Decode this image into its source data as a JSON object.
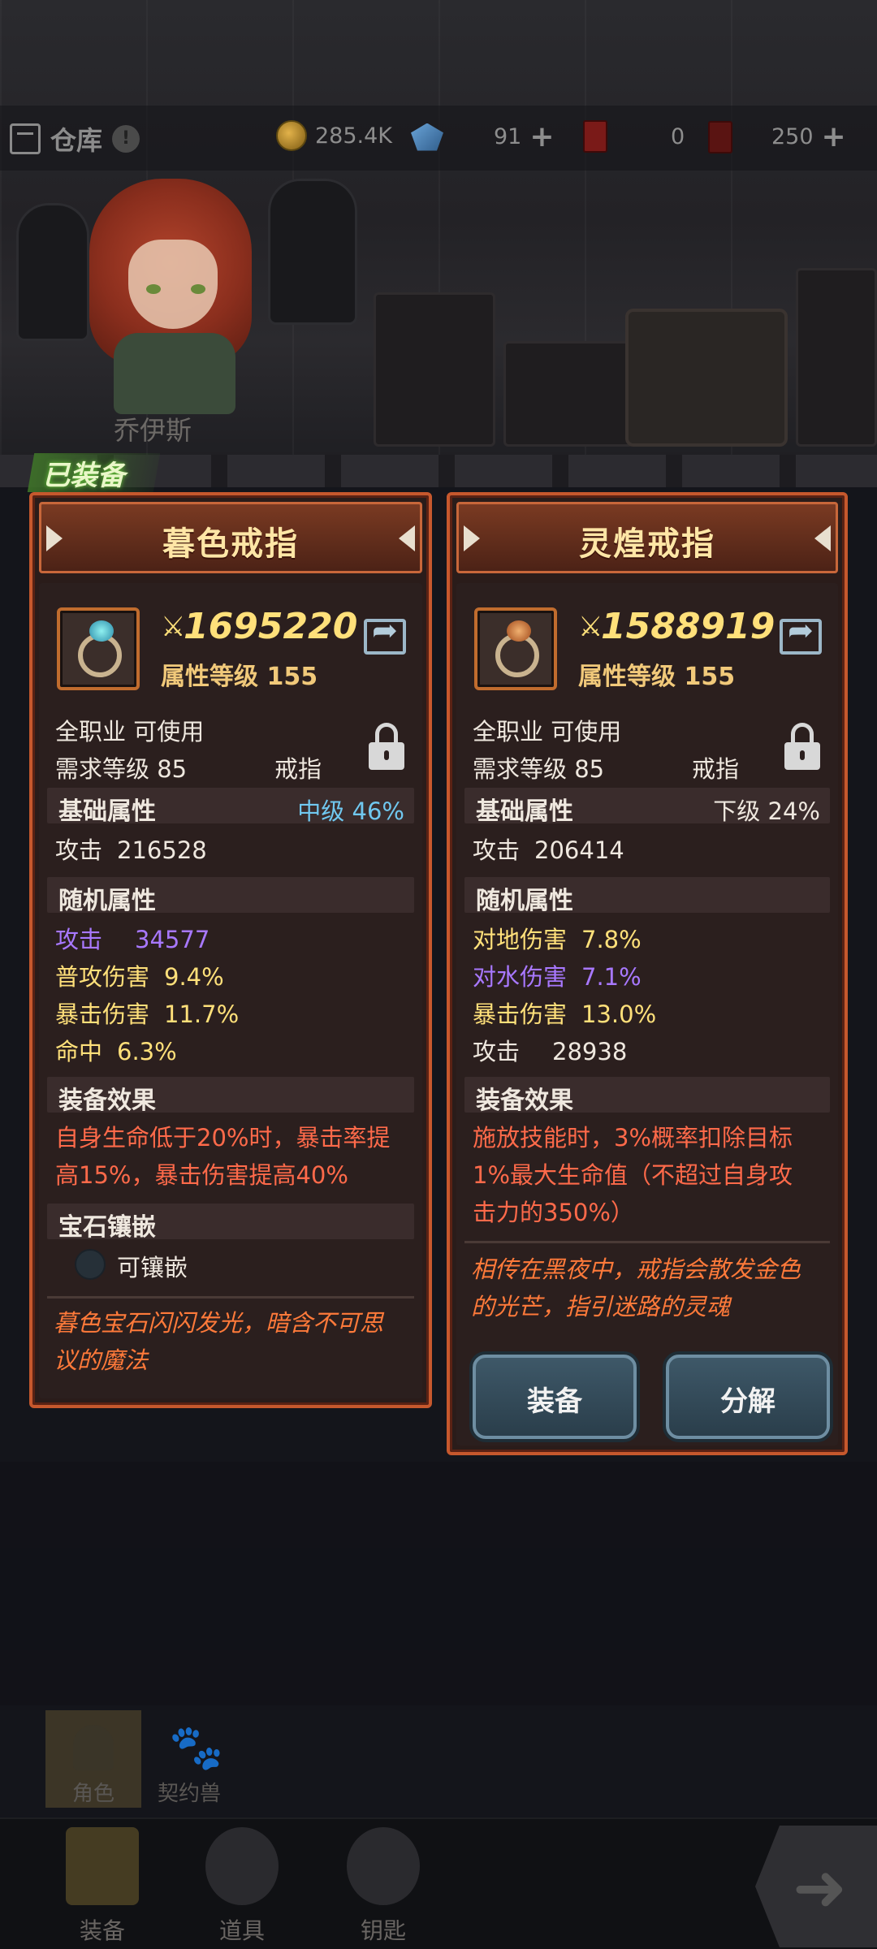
{
  "topbar": {
    "warehouse_label": "仓库",
    "info_mark": "!",
    "gold": "285.4K",
    "gems": "91",
    "ticket_red": "0",
    "ticket_dark": "250",
    "plus": "+"
  },
  "character": {
    "name": "乔伊斯",
    "equipped_badge": "已装备"
  },
  "left_item": {
    "title": "暮色戒指",
    "power": "1695220",
    "attr_level_label": "属性等级 155",
    "class_req": "全职业 可使用",
    "level_req": "需求等级 85",
    "slot": "戒指",
    "base_section": "基础属性",
    "base_grade": "中级",
    "base_percent": "46%",
    "base_stat": {
      "name": "攻击",
      "value": "216528"
    },
    "random_section": "随机属性",
    "random_stats": [
      {
        "name": "攻击",
        "value": "34577"
      },
      {
        "name": "普攻伤害",
        "value": "9.4%"
      },
      {
        "name": "暴击伤害",
        "value": "11.7%"
      },
      {
        "name": "命中",
        "value": "6.3%"
      }
    ],
    "effect_section": "装备效果",
    "effect_line1": "自身生命低于20%时，暴击率提",
    "effect_line2": "高15%，暴击伤害提高40%",
    "gem_section": "宝石镶嵌",
    "socket_label": "可镶嵌",
    "flavor_line1": "暮色宝石闪闪发光，暗含不可思",
    "flavor_line2": "议的魔法"
  },
  "right_item": {
    "title": "灵煌戒指",
    "power": "1588919",
    "attr_level_label": "属性等级 155",
    "class_req": "全职业 可使用",
    "level_req": "需求等级 85",
    "slot": "戒指",
    "base_section": "基础属性",
    "base_grade": "下级",
    "base_percent": "24%",
    "base_stat": {
      "name": "攻击",
      "value": "206414"
    },
    "random_section": "随机属性",
    "random_stats": [
      {
        "name": "对地伤害",
        "value": "7.8%"
      },
      {
        "name": "对水伤害",
        "value": "7.1%"
      },
      {
        "name": "暴击伤害",
        "value": "13.0%"
      },
      {
        "name": "攻击",
        "value": "28938"
      }
    ],
    "effect_section": "装备效果",
    "effect_line1": "施放技能时，3%概率扣除目标",
    "effect_line2": "1%最大生命值（不超过自身攻",
    "effect_line3": "击力的350%）",
    "flavor_line1": "相传在黑夜中，戒指会散发金色",
    "flavor_line2": "的光芒，指引迷路的灵魂",
    "equip_button": "装备",
    "dismantle_button": "分解"
  },
  "subtabs": {
    "character": "角色",
    "pet": "契约兽"
  },
  "bottom_nav": {
    "equipment": "装备",
    "items": "道具",
    "keys": "钥匙"
  },
  "colors": {
    "panel_border": "#c6582d",
    "power_gold": "#ffe07a",
    "effect_red": "#ff6a4a",
    "random_purple": "#a878ff",
    "grade_blue": "#70c8f0"
  }
}
